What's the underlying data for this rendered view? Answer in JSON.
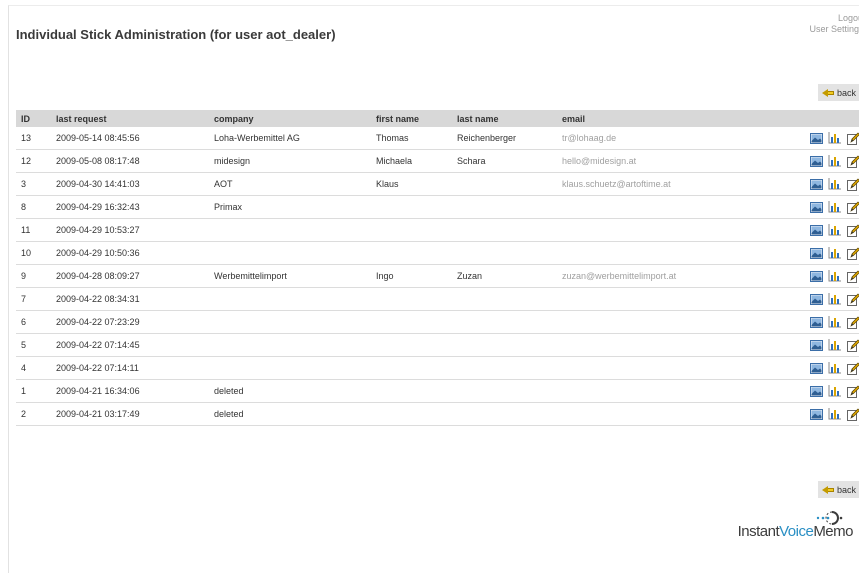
{
  "header": {
    "title": "Individual Stick Administration (for user aot_dealer)",
    "logout_label": "Logou",
    "settings_label": "User Setting"
  },
  "nav": {
    "back_label": "back"
  },
  "table": {
    "columns": {
      "id": "ID",
      "last_request": "last request",
      "company": "company",
      "first_name": "first name",
      "last_name": "last name",
      "email": "email"
    },
    "rows": [
      {
        "id": "13",
        "last_request": "2009-05-14 08:45:56",
        "company": "Loha-Werbemittel AG",
        "first_name": "Thomas",
        "last_name": "Reichenberger",
        "email": "tr@lohaag.de"
      },
      {
        "id": "12",
        "last_request": "2009-05-08 08:17:48",
        "company": "midesign",
        "first_name": "Michaela",
        "last_name": "Schara",
        "email": "hello@midesign.at"
      },
      {
        "id": "3",
        "last_request": "2009-04-30 14:41:03",
        "company": "AOT",
        "first_name": "Klaus",
        "last_name": "",
        "email": "klaus.schuetz@artoftime.at"
      },
      {
        "id": "8",
        "last_request": "2009-04-29 16:32:43",
        "company": "Primax",
        "first_name": "",
        "last_name": "",
        "email": ""
      },
      {
        "id": "11",
        "last_request": "2009-04-29 10:53:27",
        "company": "",
        "first_name": "",
        "last_name": "",
        "email": ""
      },
      {
        "id": "10",
        "last_request": "2009-04-29 10:50:36",
        "company": "",
        "first_name": "",
        "last_name": "",
        "email": ""
      },
      {
        "id": "9",
        "last_request": "2009-04-28 08:09:27",
        "company": "Werbemittelimport",
        "first_name": "Ingo",
        "last_name": "Zuzan",
        "email": "zuzan@werbemittelimport.at"
      },
      {
        "id": "7",
        "last_request": "2009-04-22 08:34:31",
        "company": "",
        "first_name": "",
        "last_name": "",
        "email": ""
      },
      {
        "id": "6",
        "last_request": "2009-04-22 07:23:29",
        "company": "",
        "first_name": "",
        "last_name": "",
        "email": ""
      },
      {
        "id": "5",
        "last_request": "2009-04-22 07:14:45",
        "company": "",
        "first_name": "",
        "last_name": "",
        "email": ""
      },
      {
        "id": "4",
        "last_request": "2009-04-22 07:14:11",
        "company": "",
        "first_name": "",
        "last_name": "",
        "email": ""
      },
      {
        "id": "1",
        "last_request": "2009-04-21 16:34:06",
        "company": "deleted",
        "first_name": "",
        "last_name": "",
        "email": ""
      },
      {
        "id": "2",
        "last_request": "2009-04-21 03:17:49",
        "company": "deleted",
        "first_name": "",
        "last_name": "",
        "email": ""
      }
    ],
    "row_actions": [
      "image-icon",
      "bar-chart-icon",
      "edit-icon"
    ]
  },
  "footer": {
    "logo_part1": "Instant",
    "logo_part2": "Voice",
    "logo_part3": "Memo"
  },
  "colors": {
    "header_bg": "#d8d8d8",
    "back_bg": "#e3e3e3",
    "email_text": "#a0a0a0",
    "logo_accent": "#2a8fc4"
  }
}
